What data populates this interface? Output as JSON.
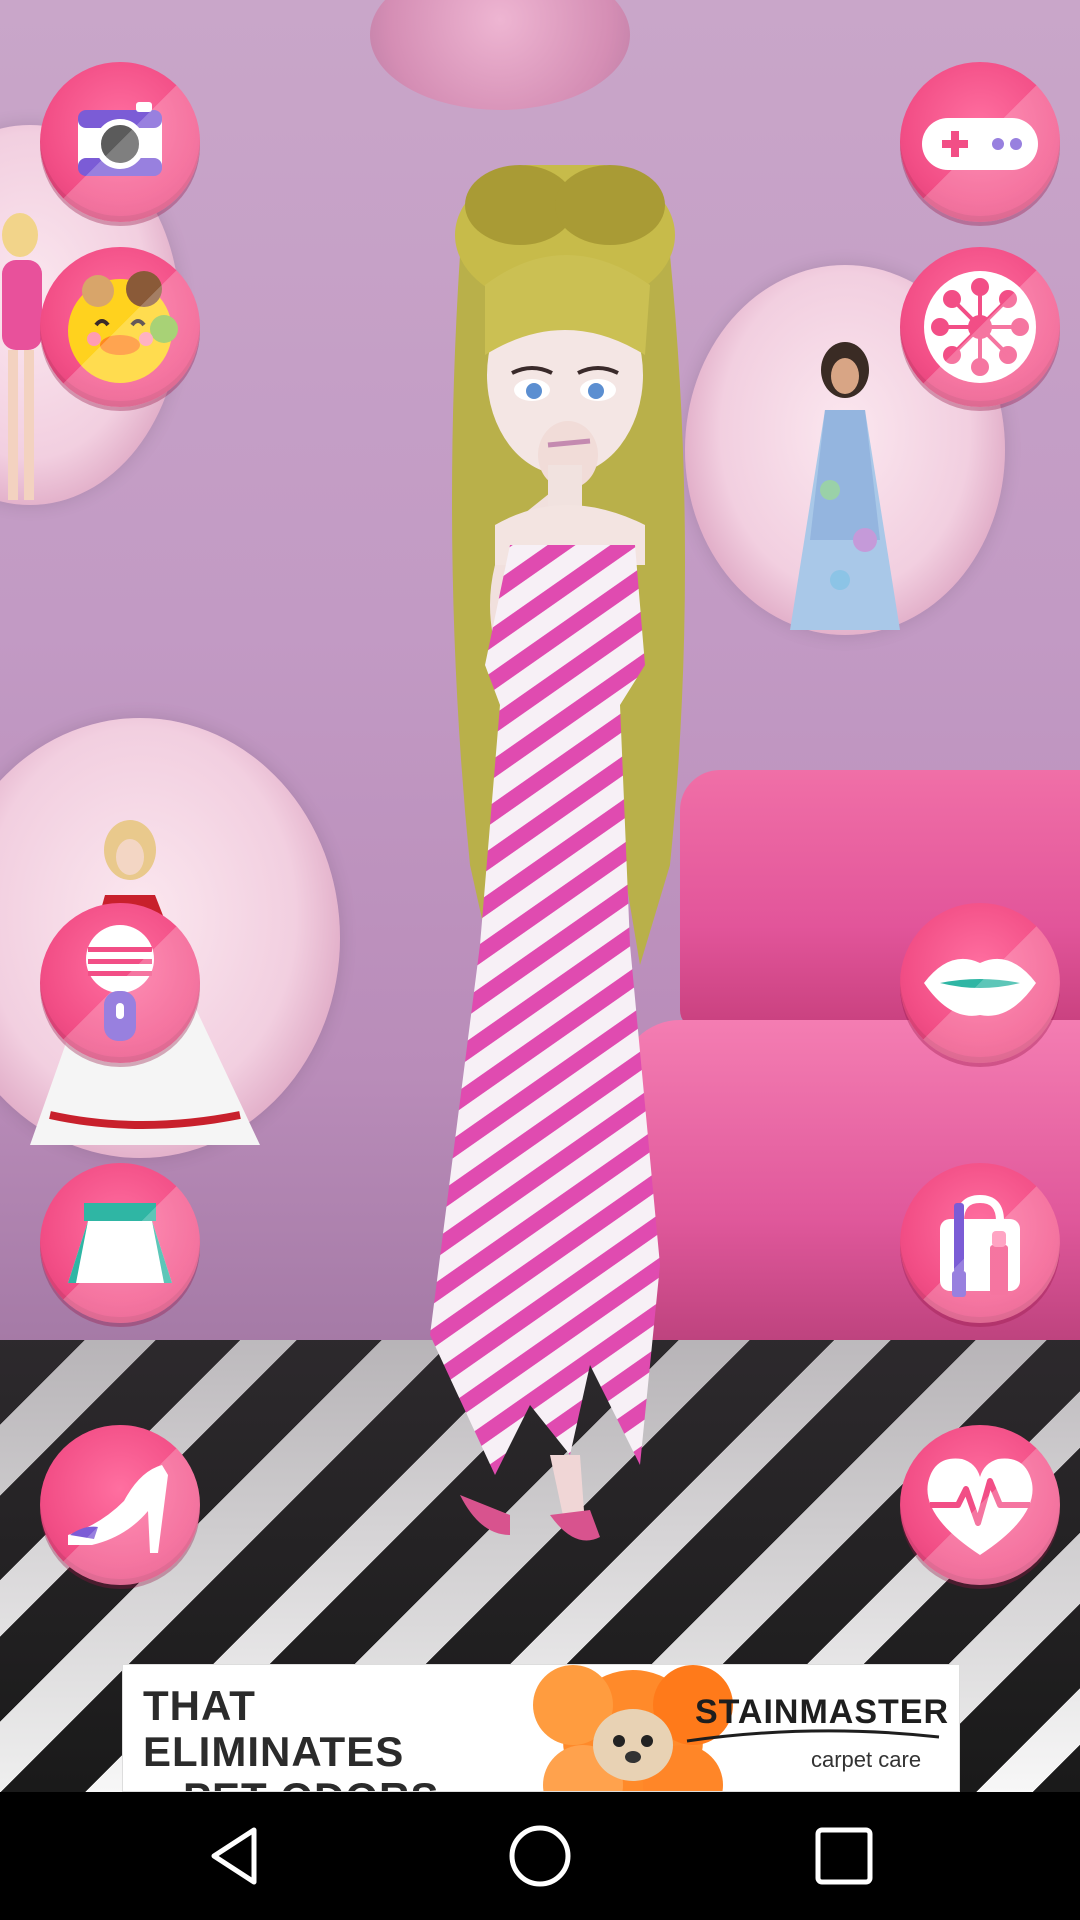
{
  "app": {
    "left_buttons": [
      {
        "name": "camera",
        "icon": "camera-icon"
      },
      {
        "name": "pets",
        "icon": "pet-duck-icon"
      },
      {
        "name": "microphone",
        "icon": "microphone-icon"
      },
      {
        "name": "clothes",
        "icon": "skirt-icon"
      },
      {
        "name": "shoes",
        "icon": "high-heel-shoe-icon"
      }
    ],
    "right_buttons": [
      {
        "name": "games",
        "icon": "gamepad-icon"
      },
      {
        "name": "hair",
        "icon": "hair-bow-icon"
      },
      {
        "name": "lips",
        "icon": "lips-icon"
      },
      {
        "name": "makeup",
        "icon": "makeup-bag-icon"
      },
      {
        "name": "health",
        "icon": "heart-pulse-icon"
      }
    ],
    "accent_color": "#f24e86"
  },
  "ad": {
    "headline_line1": "THAT ELIMINATES",
    "headline_line2": "PET ODORS",
    "brand": "STAINMASTER",
    "brand_sub": "carpet care"
  },
  "navbar": {
    "back_icon": "back-triangle-icon",
    "home_icon": "home-circle-icon",
    "recents_icon": "recents-square-icon"
  }
}
